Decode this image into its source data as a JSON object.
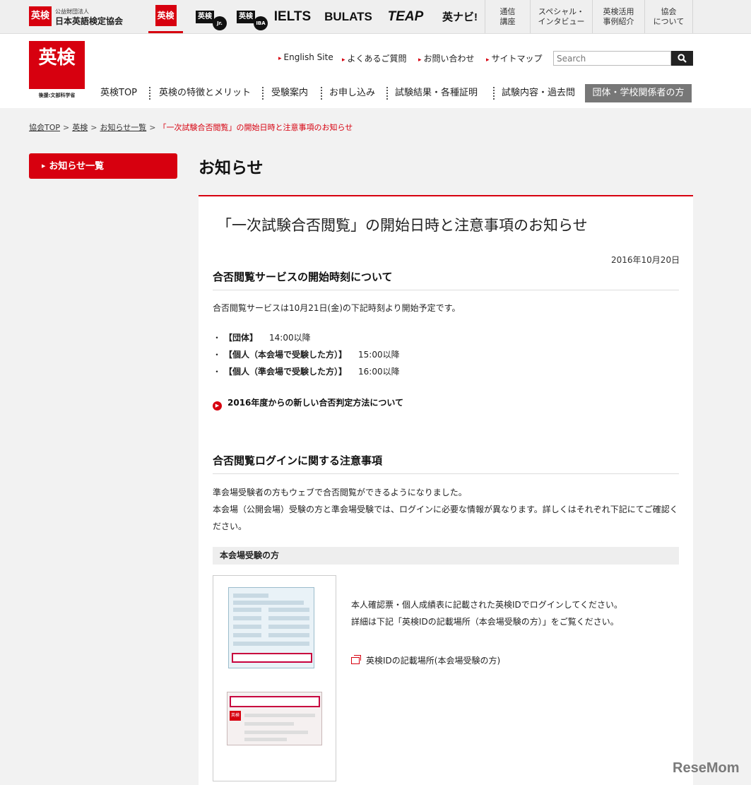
{
  "topbar": {
    "org_logo": "英検",
    "org_sub": "公益財団法人",
    "org_name": "日本英語検定協会",
    "brands": {
      "eiken": "英検",
      "jr": "英検",
      "jr_badge": "Jr.",
      "iba": "英検",
      "iba_badge": "IBA",
      "ielts": "IELTS",
      "bulats": "BULATS",
      "teap": "TEAP",
      "navi": "英ナビ!"
    },
    "nav": [
      {
        "line1": "通信",
        "line2": "講座"
      },
      {
        "line1": "スペシャル・",
        "line2": "インタビュー"
      },
      {
        "line1": "英検活用",
        "line2": "事例紹介"
      },
      {
        "line1": "協会",
        "line2": "について"
      }
    ]
  },
  "header": {
    "logo": "英検",
    "logo_sub": "後援:文部科学省",
    "util_links": [
      "English Site",
      "よくあるご質問",
      "お問い合わせ",
      "サイトマップ"
    ],
    "search_placeholder": "Search",
    "global_nav": [
      "英検TOP",
      "英検の特徴とメリット",
      "受験案内",
      "お申し込み",
      "試験結果・各種証明",
      "試験内容・過去問",
      "団体・学校関係者の方"
    ]
  },
  "breadcrumb": {
    "items": [
      "協会TOP",
      "英検",
      "お知らせ一覧"
    ],
    "sep": ">",
    "current": "「一次試験合否閲覧」の開始日時と注意事項のお知らせ"
  },
  "sidebar": {
    "button": "お知らせ一覧"
  },
  "main": {
    "page_title": "お知らせ",
    "article_title": "「一次試験合否閲覧」の開始日時と注意事項のお知らせ",
    "date": "2016年10月20日",
    "section1": {
      "heading": "合否閲覧サービスの開始時刻について",
      "text": "合否閲覧サービスは10月21日(金)の下記時刻より開始予定です。",
      "items": [
        {
          "label": "【団体】",
          "time": "14:00以降"
        },
        {
          "label": "【個人（本会場で受験した方）】",
          "time": "15:00以降"
        },
        {
          "label": "【個人（準会場で受験した方）】",
          "time": "16:00以降"
        }
      ],
      "link": "2016年度からの新しい合否判定方法について"
    },
    "section2": {
      "heading": "合否閲覧ログインに関する注意事項",
      "text1": "準会場受験者の方もウェブで合否閲覧ができるようになりました。",
      "text2": "本会場（公開会場）受験の方と準会場受験では、ログインに必要な情報が異なります。詳しくはそれぞれ下記にてご確認ください。",
      "subhead": "本会場受験の方",
      "desc1": "本人確認票・個人成績表に記載された英検IDでログインしてください。",
      "desc2": "詳細は下記「英検IDの記載場所（本会場受験の方）」をご覧ください。",
      "link": "英検IDの記載場所(本会場受験の方)",
      "doc2_tag": "英検"
    }
  },
  "watermark": "ReseMom",
  "colors": {
    "accent": "#d7000f",
    "content_bg": "#f2f2f2"
  }
}
